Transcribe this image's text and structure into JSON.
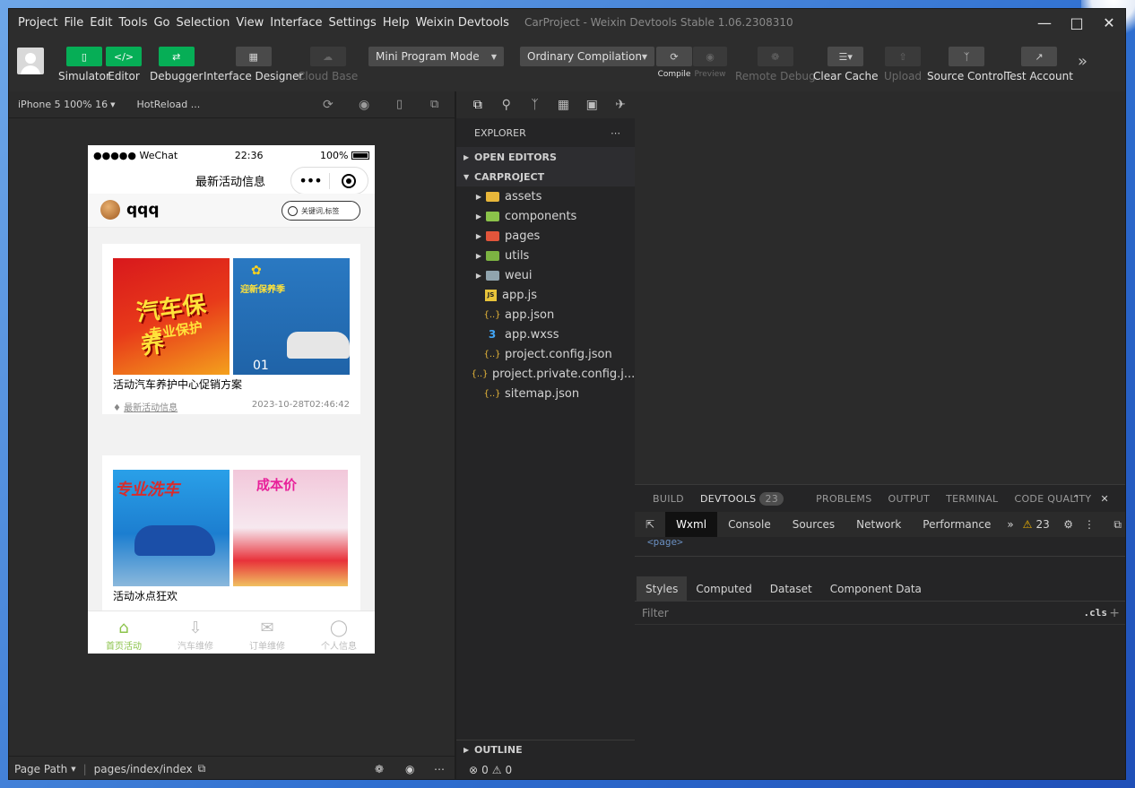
{
  "menu": [
    "Project",
    "File",
    "Edit",
    "Tools",
    "Go",
    "Selection",
    "View",
    "Interface",
    "Settings",
    "Help",
    "Weixin Devtools"
  ],
  "window_title": "CarProject - Weixin Devtools Stable 1.06.2308310",
  "toolbar": {
    "simulator": "Simulator",
    "editor": "Editor",
    "debugger": "Debugger",
    "interface_designer": "Interface Designer",
    "cloud_base": "Cloud Base",
    "mode_select": "Mini Program Mode",
    "compile_select": "Ordinary Compilation",
    "compile": "Compile",
    "preview": "Preview",
    "remote_debug": "Remote Debug",
    "clear_cache": "Clear Cache",
    "upload": "Upload",
    "source_control": "Source Control",
    "test_account": "Test Account"
  },
  "simulator": {
    "device": "iPhone 5 100% 16",
    "hotreload": "HotReload ...",
    "page_path_label": "Page Path",
    "page_path": "pages/index/index"
  },
  "phone": {
    "carrier": "●●●●● WeChat",
    "time": "22:36",
    "battery": "100%",
    "nav_title": "最新活动信息",
    "capsule_dots": "•••",
    "username": "qqq",
    "search_placeholder": "关键词,标签",
    "cards": [
      {
        "img1_text": "汽车保养",
        "img1_sub": "专业保护",
        "img2_text": "迎新保养季",
        "img2_num": "01",
        "title": "活动汽车养护中心促销方案",
        "tag": "最新活动信息",
        "date": "2023-10-28T02:46:42"
      },
      {
        "img1_text": "专业洗车",
        "img2_text": "成本价",
        "title": "活动冰点狂欢"
      }
    ],
    "tabs": [
      {
        "label": "首页活动",
        "icon": "home-icon",
        "active": true
      },
      {
        "label": "汽车维修",
        "icon": "download-box-icon",
        "active": false
      },
      {
        "label": "订单维修",
        "icon": "chat-icon",
        "active": false
      },
      {
        "label": "个人信息",
        "icon": "person-icon",
        "active": false
      }
    ]
  },
  "explorer": {
    "title": "EXPLORER",
    "open_editors": "OPEN EDITORS",
    "project": "CARPROJECT",
    "items": [
      {
        "name": "assets",
        "type": "folder",
        "color": "#e8b73a"
      },
      {
        "name": "components",
        "type": "folder",
        "color": "#8bc34a"
      },
      {
        "name": "pages",
        "type": "folder",
        "color": "#e2553b"
      },
      {
        "name": "utils",
        "type": "folder",
        "color": "#7cb342"
      },
      {
        "name": "weui",
        "type": "folder",
        "color": "#90a4ae"
      },
      {
        "name": "app.js",
        "type": "js",
        "icon_text": "JS"
      },
      {
        "name": "app.json",
        "type": "json",
        "icon_text": "{..}"
      },
      {
        "name": "app.wxss",
        "type": "css",
        "icon_text": "3"
      },
      {
        "name": "project.config.json",
        "type": "json",
        "icon_text": "{..}"
      },
      {
        "name": "project.private.config.j...",
        "type": "json",
        "icon_text": "{..}"
      },
      {
        "name": "sitemap.json",
        "type": "json",
        "icon_text": "{..}"
      }
    ],
    "outline": "OUTLINE",
    "status_errors": "0",
    "status_warnings": "0"
  },
  "devtools": {
    "tabs": [
      "BUILD",
      "DEVTOOLS",
      "PROBLEMS",
      "OUTPUT",
      "TERMINAL",
      "CODE QUALITY"
    ],
    "devtools_count": "23",
    "subtabs": [
      "Wxml",
      "Console",
      "Sources",
      "Network",
      "Performance"
    ],
    "warning_count": "23",
    "code_line": "<page>",
    "style_tabs": [
      "Styles",
      "Computed",
      "Dataset",
      "Component Data"
    ],
    "filter_placeholder": "Filter",
    "cls": ".cls"
  },
  "colors": {
    "accent_green": "#06ae56",
    "tab_active": "#8bc34a"
  }
}
